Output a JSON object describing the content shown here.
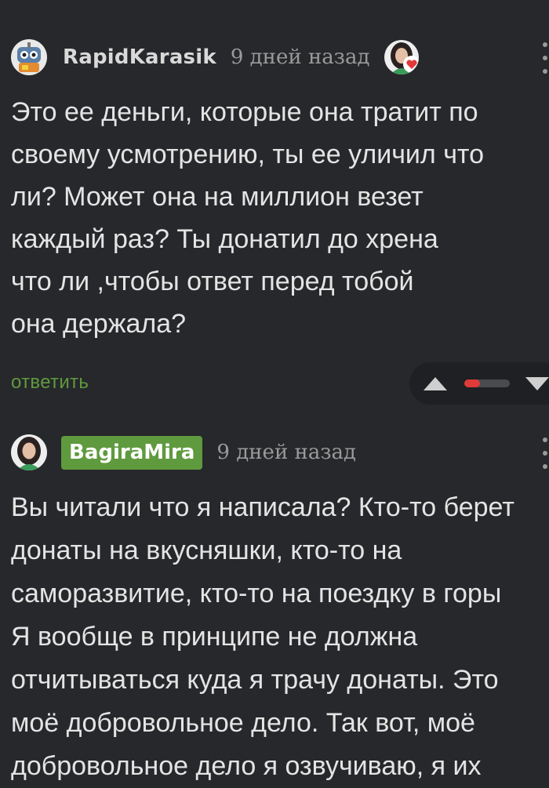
{
  "comments": [
    {
      "username": "RapidKarasik",
      "time": "9 дней назад",
      "avatar_icon": "robot-avatar",
      "body": "Это ее деньги, которые она тратит по\nсвоему усмотрению, ты ее уличил что\nли? Может она на миллион везет\nкаждый раз? Ты донатил до хрена\nчто ли ,чтобы ответ перед тобой\nона держала?",
      "reply_label": "ответить",
      "vote_ratio": 0.35
    },
    {
      "username": "BagiraMira",
      "time": "9 дней назад",
      "avatar_icon": "woman-avatar",
      "body": "Вы читали что я написала? Кто-то берет\nдонаты на вкусняшки, кто-то на\nсаморазвитие, кто-то на поездку в горы\nЯ вообще в принципе не должна\nотчитываться куда я трачу донаты. Это\nмоё добровольное дело. Так вот, моё\nдобровольное дело я озвучиваю, я их"
    }
  ],
  "colors": {
    "background": "#27282b",
    "accent_green": "#5f9a3e",
    "vote_red": "#e03a3a"
  }
}
